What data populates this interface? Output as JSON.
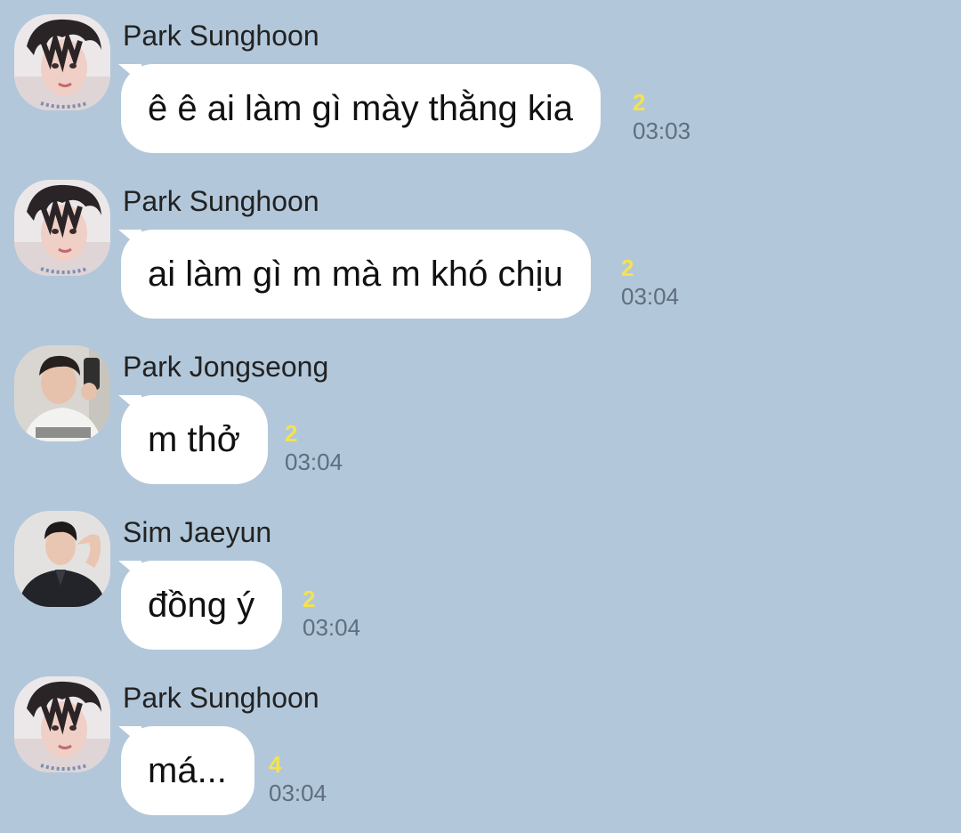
{
  "colors": {
    "background": "#b2c7da",
    "bubble": "#ffffff",
    "unread": "#f5e24f",
    "time": "#5e6e7d"
  },
  "messages": [
    {
      "sender": "Park Sunghoon",
      "avatar": "profile-photo-icon",
      "text": "ê ê ai làm gì mày thằng kia",
      "unread": "2",
      "time": "03:03"
    },
    {
      "sender": "Park Sunghoon",
      "avatar": "profile-photo-icon",
      "text": "ai làm gì m mà m khó chịu",
      "unread": "2",
      "time": "03:04"
    },
    {
      "sender": "Park Jongseong",
      "avatar": "profile-photo-icon",
      "text": "m thở",
      "unread": "2",
      "time": "03:04"
    },
    {
      "sender": "Sim Jaeyun",
      "avatar": "profile-photo-icon",
      "text": "đồng ý",
      "unread": "2",
      "time": "03:04"
    },
    {
      "sender": "Park Sunghoon",
      "avatar": "profile-photo-icon",
      "text": "má...",
      "unread": "4",
      "time": "03:04"
    }
  ]
}
